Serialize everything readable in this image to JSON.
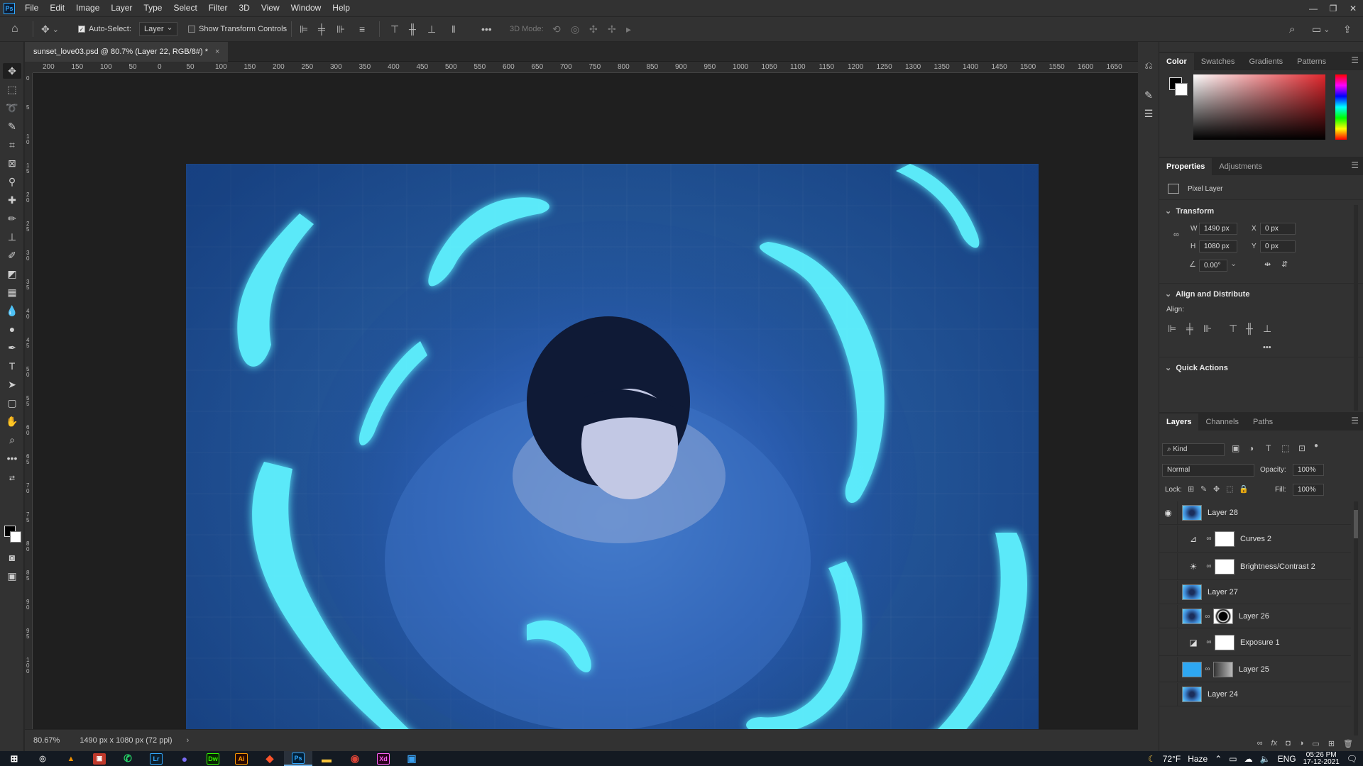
{
  "menubar": {
    "app_logo": "Ps",
    "items": [
      "File",
      "Edit",
      "Image",
      "Layer",
      "Type",
      "Select",
      "Filter",
      "3D",
      "View",
      "Window",
      "Help"
    ]
  },
  "options": {
    "auto_select_label": "Auto-Select:",
    "auto_select_checked": true,
    "auto_select_target": "Layer",
    "show_transform_label": "Show Transform Controls",
    "show_transform_checked": false,
    "three_d_mode_label": "3D Mode:"
  },
  "document": {
    "tab_title": "sunset_love03.psd @ 80.7% (Layer 22, RGB/8#) *",
    "tab_close": "×",
    "ruler_top": [
      "200",
      "150",
      "100",
      "50",
      "0",
      "50",
      "100",
      "150",
      "200",
      "250",
      "300",
      "350",
      "400",
      "450",
      "500",
      "550",
      "600",
      "650",
      "700",
      "750",
      "800",
      "850",
      "900",
      "950",
      "1000",
      "1050",
      "1100",
      "1150",
      "1200",
      "1250",
      "1300",
      "1350",
      "1400",
      "1450",
      "1500",
      "1550",
      "1600",
      "1650"
    ],
    "ruler_left": [
      "0",
      "5",
      "1\n0",
      "1\n5",
      "2\n0",
      "2\n5",
      "3\n0",
      "3\n5",
      "4\n0",
      "4\n5",
      "5\n0",
      "5\n5",
      "6\n0",
      "6\n5",
      "7\n0",
      "7\n5",
      "8\n0",
      "8\n5",
      "9\n0",
      "9\n5",
      "1\n0\n0"
    ]
  },
  "status": {
    "zoom": "80.67%",
    "doc_info": "1490 px x 1080 px (72 ppi)",
    "arrow": "›"
  },
  "panels": {
    "color_tabs": [
      "Color",
      "Swatches",
      "Gradients",
      "Patterns"
    ],
    "properties_tabs": [
      "Properties",
      "Adjustments"
    ],
    "pixel_layer_label": "Pixel Layer",
    "transform_header": "Transform",
    "w_label": "W",
    "w_value": "1490 px",
    "h_label": "H",
    "h_value": "1080 px",
    "x_label": "X",
    "x_value": "0 px",
    "y_label": "Y",
    "y_value": "0 px",
    "angle_value": "0.00°",
    "align_header": "Align and Distribute",
    "align_label": "Align:",
    "quick_actions_header": "Quick Actions",
    "more": "•••"
  },
  "layers_panel": {
    "tabs": [
      "Layers",
      "Channels",
      "Paths"
    ],
    "filter_kind": "Kind",
    "blend_mode": "Normal",
    "opacity_label": "Opacity:",
    "opacity_value": "100%",
    "lock_label": "Lock:",
    "fill_label": "Fill:",
    "fill_value": "100%",
    "layers": [
      {
        "name": "Layer 28",
        "visible": true
      },
      {
        "name": "Curves 2",
        "visible": false
      },
      {
        "name": "Brightness/Contrast 2",
        "visible": false
      },
      {
        "name": "Layer 27",
        "visible": false
      },
      {
        "name": "Layer 26",
        "visible": false
      },
      {
        "name": "Exposure 1",
        "visible": false
      },
      {
        "name": "Layer 25",
        "visible": false
      },
      {
        "name": "Layer 24",
        "visible": false
      }
    ]
  },
  "taskbar": {
    "apps": [
      "Lr",
      "Dw",
      "Ai",
      "Ps",
      "Xd"
    ],
    "weather": "72°F",
    "weather_desc": "Haze",
    "language": "ENG",
    "time": "05:26 PM",
    "date": "17-12-2021"
  },
  "colors": {
    "accent": "#31a8ff",
    "panel_bg": "#323232",
    "canvas_bg": "#1f1f1f",
    "artwork_blue": "#2e6aa8",
    "koi_cyan": "#5ef2ff"
  }
}
